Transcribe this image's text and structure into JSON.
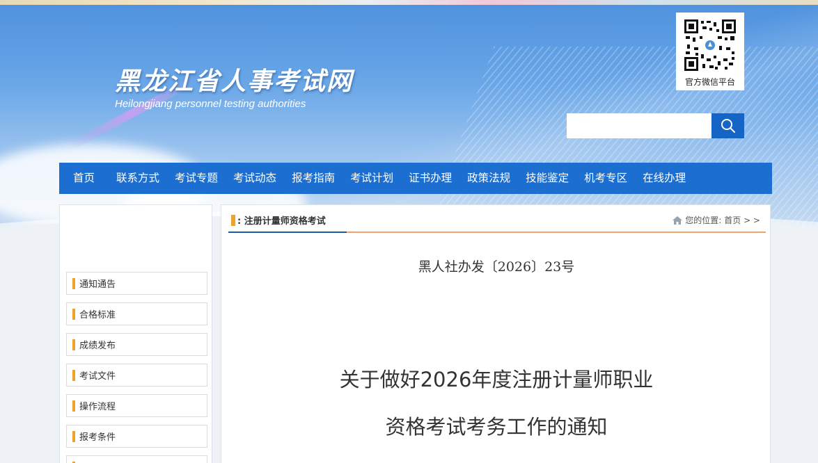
{
  "header": {
    "site_title": "黑龙江省人事考试网",
    "site_subtitle": "Heilongjiang personnel testing authorities",
    "qr_label": "官方微信平台",
    "search": {
      "placeholder": "",
      "button_icon": "search-icon"
    }
  },
  "nav": {
    "items": [
      "首页",
      "联系方式",
      "考试专题",
      "考试动态",
      "报考指南",
      "考试计划",
      "证书办理",
      "政策法规",
      "技能鉴定",
      "机考专区",
      "在线办理"
    ]
  },
  "sidebar": {
    "items": [
      "通知通告",
      "合格标准",
      "成绩发布",
      "考试文件",
      "操作流程",
      "报考条件"
    ]
  },
  "main": {
    "section_title": ": 注册计量师资格考试",
    "location_label": "您的位置:",
    "location_home": "首页",
    "location_sep": " > >",
    "doc_number": "黑人社办发〔2026〕23号",
    "doc_title_line1": "关于做好2026年度注册计量师职业",
    "doc_title_line2": "资格考试考务工作的通知"
  },
  "colors": {
    "nav_bg": "#1c6fd1",
    "accent_orange": "#f0a22e",
    "search_btn": "#1565c7"
  }
}
